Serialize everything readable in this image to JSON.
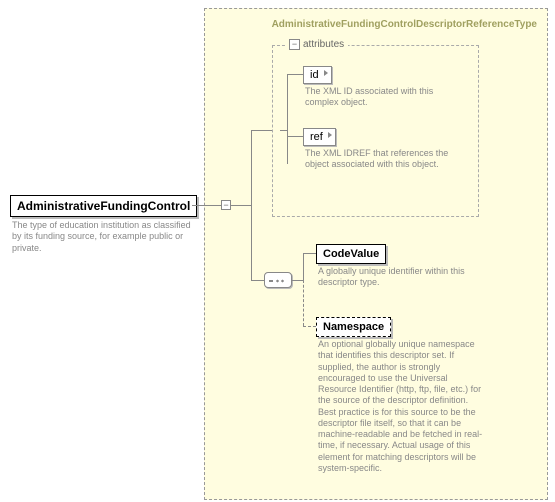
{
  "type_name": "AdministrativeFundingControlDescriptorReferenceType",
  "root": {
    "label": "AdministrativeFundingControl",
    "description": "The type of education institution as classified by its funding source, for example public or private."
  },
  "attributes_header": "attributes",
  "attributes": [
    {
      "name": "id",
      "description": "The XML ID associated with this complex object."
    },
    {
      "name": "ref",
      "description": "The XML IDREF that references the object associated with this object."
    }
  ],
  "elements": [
    {
      "name": "CodeValue",
      "optional": false,
      "description": "A globally unique identifier within this descriptor type."
    },
    {
      "name": "Namespace",
      "optional": true,
      "description": "An optional globally unique namespace that identifies this descriptor set. If supplied, the author is strongly encouraged to use the Universal Resource Identifier (http, ftp, file, etc.) for the source of the descriptor definition. Best practice is for this source to be the descriptor file itself, so that it can be machine-readable and be fetched in real-time, if necessary. Actual usage of this element for matching descriptors will be system-specific."
    }
  ]
}
